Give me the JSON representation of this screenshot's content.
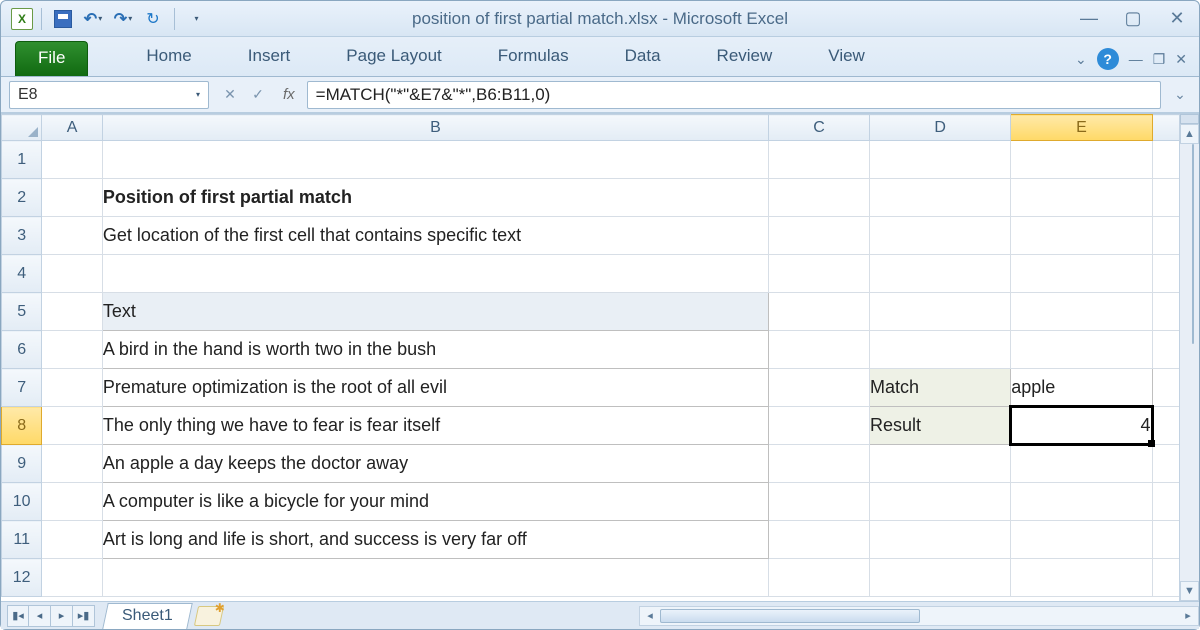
{
  "app": {
    "title": "position of first partial match.xlsx  -  Microsoft Excel"
  },
  "ribbon": {
    "file": "File",
    "tabs": [
      "Home",
      "Insert",
      "Page Layout",
      "Formulas",
      "Data",
      "Review",
      "View"
    ]
  },
  "formula_bar": {
    "namebox": "E8",
    "fx": "fx",
    "formula": "=MATCH(\"*\"&E7&\"*\",B6:B11,0)"
  },
  "columns": [
    "A",
    "B",
    "C",
    "D",
    "E"
  ],
  "rows": [
    "1",
    "2",
    "3",
    "4",
    "5",
    "6",
    "7",
    "8",
    "9",
    "10",
    "11",
    "12"
  ],
  "selected_col": "E",
  "selected_row": "8",
  "content": {
    "title": "Position of first partial match",
    "subtitle": "Get location of the first cell that contains specific text",
    "text_header": "Text",
    "text_rows": [
      "A bird in the hand is worth two in the bush",
      "Premature optimization is the root of all evil",
      "The only thing we have to fear is fear itself",
      "An apple a day keeps the doctor away",
      "A computer is like a bicycle for your mind",
      "Art is long and life is short, and success is very far off"
    ],
    "match_label": "Match",
    "match_value": "apple",
    "result_label": "Result",
    "result_value": "4"
  },
  "sheetbar": {
    "sheet": "Sheet1"
  }
}
